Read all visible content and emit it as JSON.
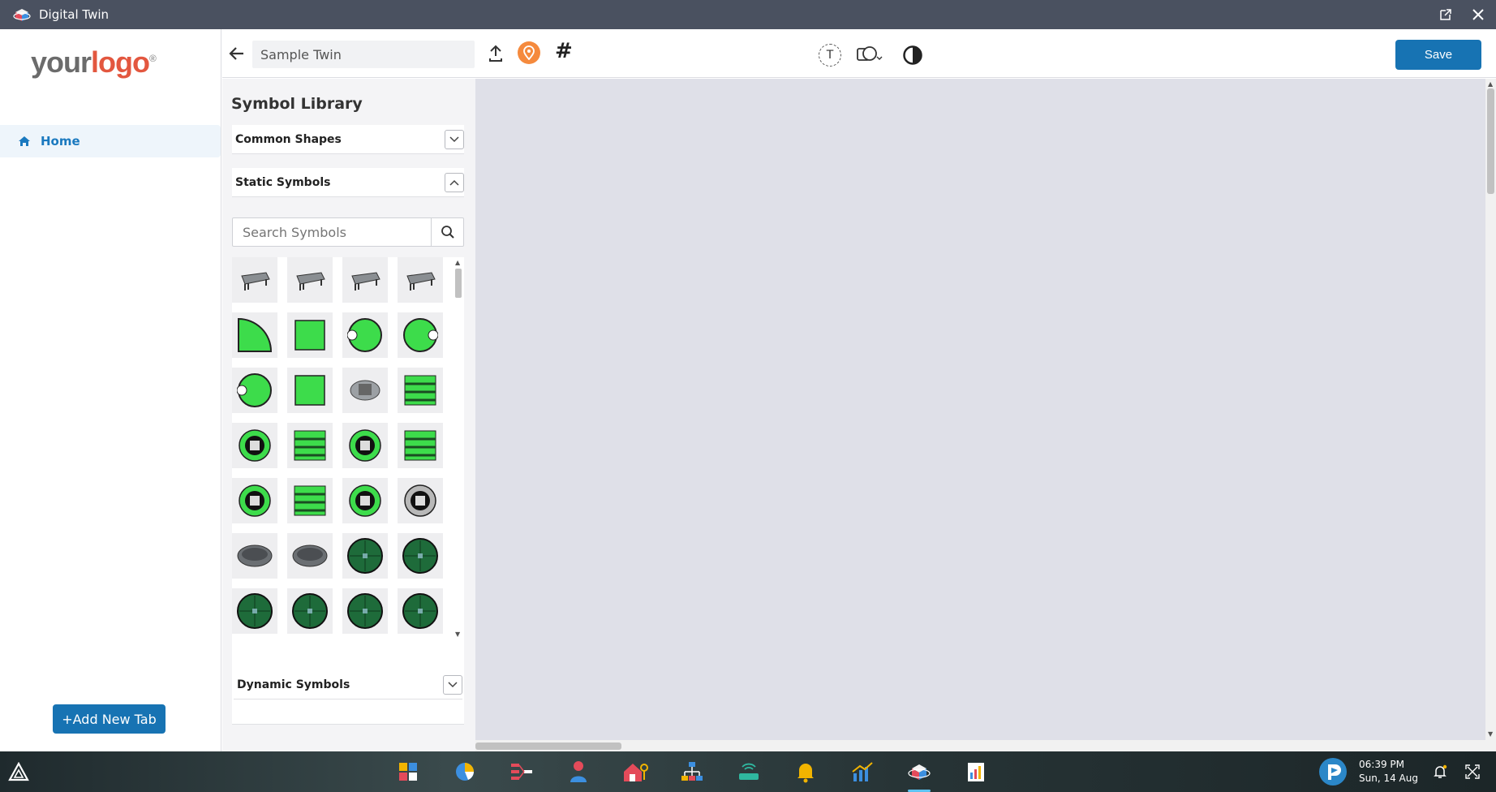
{
  "window": {
    "title": "Digital Twin"
  },
  "sidebar": {
    "logo": {
      "word1": "your",
      "word2": "logo",
      "mark": "®"
    },
    "nav": [
      {
        "label": "Home",
        "icon": "home-icon",
        "active": true
      }
    ],
    "add_tab_label": "+Add New Tab"
  },
  "toolbar": {
    "twin_name": "Sample Twin",
    "text_tool_label": "T",
    "save_label": "Save"
  },
  "library": {
    "title": "Symbol Library",
    "sections": {
      "common": {
        "label": "Common Shapes",
        "expanded": false
      },
      "static": {
        "label": "Static Symbols",
        "expanded": true
      },
      "dynamic": {
        "label": "Dynamic Symbols",
        "expanded": false
      }
    },
    "search_placeholder": "Search Symbols",
    "symbols": [
      "conveyor-curve",
      "conveyor-long",
      "conveyor-short",
      "conveyor-angled",
      "green-quarter-curve",
      "green-rect",
      "green-half-round-right",
      "green-half-round-left",
      "green-half-round-bottom",
      "green-square",
      "gray-machine",
      "green-rack",
      "green-round-machine-1",
      "green-module-vertical",
      "green-round-machine-2",
      "green-rack-2",
      "green-round-machine-3",
      "green-module-vertical-2",
      "green-round-machine-4",
      "gray-round-machine",
      "gray-tank-1",
      "gray-tank-2",
      "dark-green-disc-1",
      "dark-green-disc-2",
      "dark-green-disc-3",
      "dark-green-disc-4",
      "dark-green-disc-5",
      "dark-green-disc-6"
    ]
  },
  "taskbar": {
    "apps": [
      "dashboard-icon",
      "pie-chart-icon",
      "flow-icon",
      "user-icon",
      "home-key-icon",
      "hierarchy-icon",
      "router-icon",
      "bell-alert-icon",
      "trend-chart-icon",
      "digital-twin-icon",
      "report-icon"
    ],
    "active_app": "digital-twin-icon",
    "time": "06:39 PM",
    "date": "Sun, 14 Aug"
  },
  "colors": {
    "accent": "#1773b3",
    "pin": "#f58a3d",
    "canvas": "#dfe0e8",
    "titlebar": "#4a5160"
  }
}
